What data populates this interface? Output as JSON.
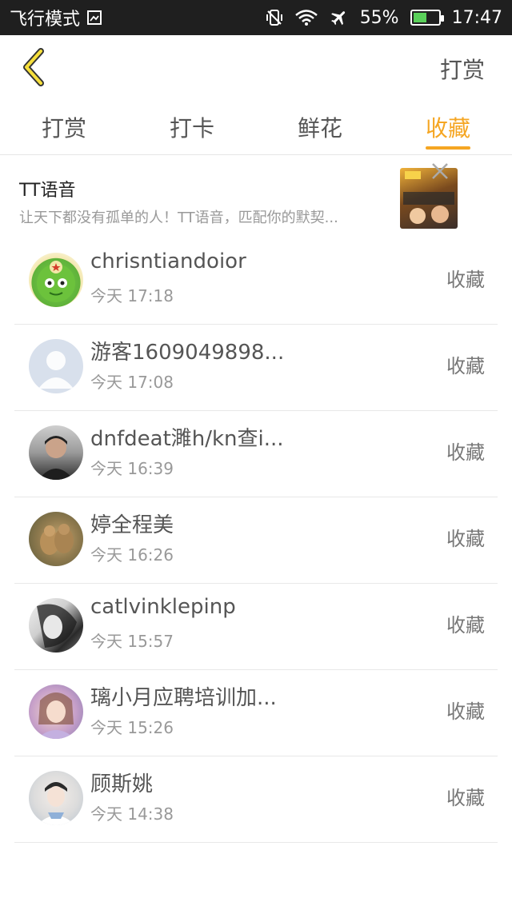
{
  "status_bar": {
    "mode": "飞行模式",
    "battery": "55%",
    "battery_level": 0.55,
    "time": "17:47"
  },
  "header": {
    "title": "打赏"
  },
  "tabs": [
    {
      "label": "打赏",
      "active": false
    },
    {
      "label": "打卡",
      "active": false
    },
    {
      "label": "鲜花",
      "active": false
    },
    {
      "label": "收藏",
      "active": true
    }
  ],
  "ad": {
    "title": "TT语音",
    "description": "让天下都没有孤单的人！TT语音，匹配你的默契..."
  },
  "list": [
    {
      "name": "chrisntiandoior",
      "time": "今天 17:18",
      "action": "收藏"
    },
    {
      "name": "游客1609049898...",
      "time": "今天 17:08",
      "action": "收藏"
    },
    {
      "name": "dnfdeat濉h/kn查i...",
      "time": "今天 16:39",
      "action": "收藏"
    },
    {
      "name": "婷全程美",
      "time": "今天 16:26",
      "action": "收藏"
    },
    {
      "name": "catlvinklepinp",
      "time": "今天 15:57",
      "action": "收藏"
    },
    {
      "name": "璃小月应聘培训加...",
      "time": "今天 15:26",
      "action": "收藏"
    },
    {
      "name": "顾斯姚",
      "time": "今天 14:38",
      "action": "收藏"
    }
  ],
  "colors": {
    "accent": "#f5a623",
    "status_bar_bg": "#1f1f1f",
    "divider": "#e8e8e8"
  }
}
